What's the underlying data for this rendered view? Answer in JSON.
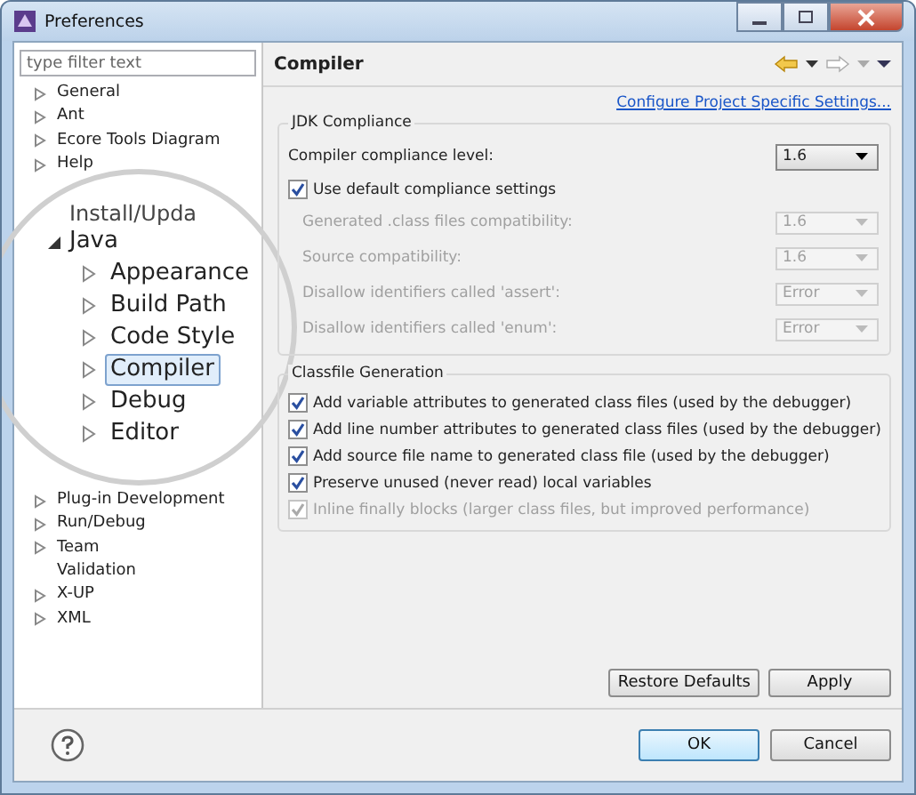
{
  "window": {
    "title": "Preferences"
  },
  "filter": {
    "placeholder": "type filter text"
  },
  "tree_top": [
    {
      "label": "General",
      "has_children": true
    },
    {
      "label": "Ant",
      "has_children": true
    },
    {
      "label": "Ecore Tools Diagram",
      "has_children": true
    },
    {
      "label": "Help",
      "has_children": true
    }
  ],
  "magnifier": {
    "items": [
      {
        "label": "Install/Upda",
        "has_children": false
      },
      {
        "label": "Java",
        "has_children": true,
        "expanded": true,
        "children": [
          {
            "label": "Appearance",
            "has_children": true,
            "selected": false
          },
          {
            "label": "Build Path",
            "has_children": true,
            "selected": false
          },
          {
            "label": "Code Style",
            "has_children": true,
            "selected": false
          },
          {
            "label": "Compiler",
            "has_children": true,
            "selected": true
          },
          {
            "label": "Debug",
            "has_children": true,
            "selected": false
          },
          {
            "label": "Editor",
            "has_children": true,
            "selected": false
          }
        ]
      }
    ]
  },
  "tree_bottom": [
    {
      "label": "Plug-in Development",
      "has_children": true
    },
    {
      "label": "Run/Debug",
      "has_children": true
    },
    {
      "label": "Team",
      "has_children": true
    },
    {
      "label": "Validation",
      "has_children": false
    },
    {
      "label": "X-UP",
      "has_children": true
    },
    {
      "label": "XML",
      "has_children": true
    }
  ],
  "page": {
    "title": "Compiler",
    "link": "Configure Project Specific Settings..."
  },
  "jdk_group": {
    "title": "JDK Compliance",
    "level_row": {
      "label": "Compiler compliance level:",
      "value": "1.6"
    },
    "use_default": {
      "label": "Use default compliance settings",
      "checked": true
    },
    "rows": [
      {
        "label": "Generated .class files compatibility:",
        "value": "1.6",
        "disabled": true
      },
      {
        "label": "Source compatibility:",
        "value": "1.6",
        "disabled": true
      },
      {
        "label": "Disallow identifiers called 'assert':",
        "value": "Error",
        "disabled": true
      },
      {
        "label": "Disallow identifiers called 'enum':",
        "value": "Error",
        "disabled": true
      }
    ]
  },
  "classfile_group": {
    "title": "Classfile Generation",
    "options": [
      {
        "label": "Add variable attributes to generated class files (used by the debugger)",
        "checked": true,
        "disabled": false
      },
      {
        "label": "Add line number attributes to generated class files (used by the debugger)",
        "checked": true,
        "disabled": false
      },
      {
        "label": "Add source file name to generated class file (used by the debugger)",
        "checked": true,
        "disabled": false
      },
      {
        "label": "Preserve unused (never read) local variables",
        "checked": true,
        "disabled": false
      },
      {
        "label": "Inline finally blocks (larger class files, but improved performance)",
        "checked": true,
        "disabled": true
      }
    ]
  },
  "page_buttons": [
    "Restore Defaults",
    "Apply"
  ],
  "dialog_buttons": [
    {
      "label": "OK",
      "default": true
    },
    {
      "label": "Cancel",
      "default": false
    }
  ]
}
